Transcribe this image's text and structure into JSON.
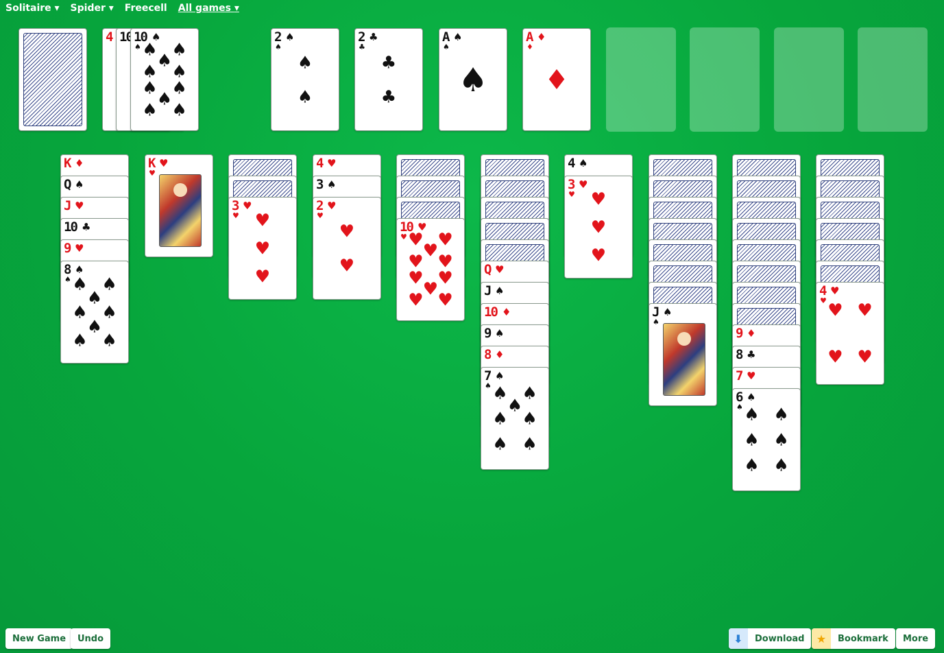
{
  "nav": {
    "solitaire": "Solitaire",
    "spider": "Spider",
    "freecell": "Freecell",
    "all_games": "All games"
  },
  "waste_cards": [
    {
      "rank": "4",
      "suit": "♦",
      "color": "red"
    },
    {
      "rank": "10",
      "suit": "♠",
      "color": "black"
    },
    {
      "rank": "10",
      "suit": "♠",
      "color": "black"
    }
  ],
  "foundations": [
    {
      "rank": "2",
      "suit": "♠",
      "color": "black"
    },
    {
      "rank": "2",
      "suit": "♣",
      "color": "black"
    },
    {
      "rank": "A",
      "suit": "♠",
      "color": "black"
    },
    {
      "rank": "A",
      "suit": "♦",
      "color": "red"
    }
  ],
  "tableau": [
    {
      "hidden": 0,
      "cards": [
        {
          "rank": "K",
          "suit": "♦",
          "color": "red"
        },
        {
          "rank": "Q",
          "suit": "♠",
          "color": "black"
        },
        {
          "rank": "J",
          "suit": "♥",
          "color": "red"
        },
        {
          "rank": "10",
          "suit": "♣",
          "color": "black"
        },
        {
          "rank": "9",
          "suit": "♥",
          "color": "red"
        },
        {
          "rank": "8",
          "suit": "♠",
          "color": "black"
        }
      ]
    },
    {
      "hidden": 0,
      "cards": [
        {
          "rank": "K",
          "suit": "♥",
          "color": "red"
        }
      ]
    },
    {
      "hidden": 2,
      "cards": [
        {
          "rank": "3",
          "suit": "♥",
          "color": "red"
        }
      ]
    },
    {
      "hidden": 0,
      "cards": [
        {
          "rank": "4",
          "suit": "♥",
          "color": "red"
        },
        {
          "rank": "3",
          "suit": "♠",
          "color": "black"
        },
        {
          "rank": "2",
          "suit": "♥",
          "color": "red"
        }
      ]
    },
    {
      "hidden": 3,
      "cards": [
        {
          "rank": "10",
          "suit": "♥",
          "color": "red"
        }
      ]
    },
    {
      "hidden": 5,
      "cards": [
        {
          "rank": "Q",
          "suit": "♥",
          "color": "red"
        },
        {
          "rank": "J",
          "suit": "♠",
          "color": "black"
        },
        {
          "rank": "10",
          "suit": "♦",
          "color": "red"
        },
        {
          "rank": "9",
          "suit": "♠",
          "color": "black"
        },
        {
          "rank": "8",
          "suit": "♦",
          "color": "red"
        },
        {
          "rank": "7",
          "suit": "♠",
          "color": "black"
        }
      ]
    },
    {
      "hidden": 0,
      "cards": [
        {
          "rank": "4",
          "suit": "♠",
          "color": "black"
        },
        {
          "rank": "3",
          "suit": "♥",
          "color": "red"
        }
      ]
    },
    {
      "hidden": 7,
      "cards": [
        {
          "rank": "J",
          "suit": "♠",
          "color": "black"
        }
      ]
    },
    {
      "hidden": 8,
      "cards": [
        {
          "rank": "9",
          "suit": "♦",
          "color": "red"
        },
        {
          "rank": "8",
          "suit": "♣",
          "color": "black"
        },
        {
          "rank": "7",
          "suit": "♥",
          "color": "red"
        },
        {
          "rank": "6",
          "suit": "♠",
          "color": "black"
        }
      ]
    },
    {
      "hidden": 6,
      "cards": [
        {
          "rank": "4",
          "suit": "♥",
          "color": "red"
        }
      ]
    }
  ],
  "buttons": {
    "new_game": "New Game",
    "undo": "Undo",
    "download": "Download",
    "bookmark": "Bookmark",
    "more": "More"
  },
  "colors": {
    "red": "#e2141b",
    "black": "#111111",
    "felt": "#07a63c",
    "button_text": "#1b6e3a"
  }
}
